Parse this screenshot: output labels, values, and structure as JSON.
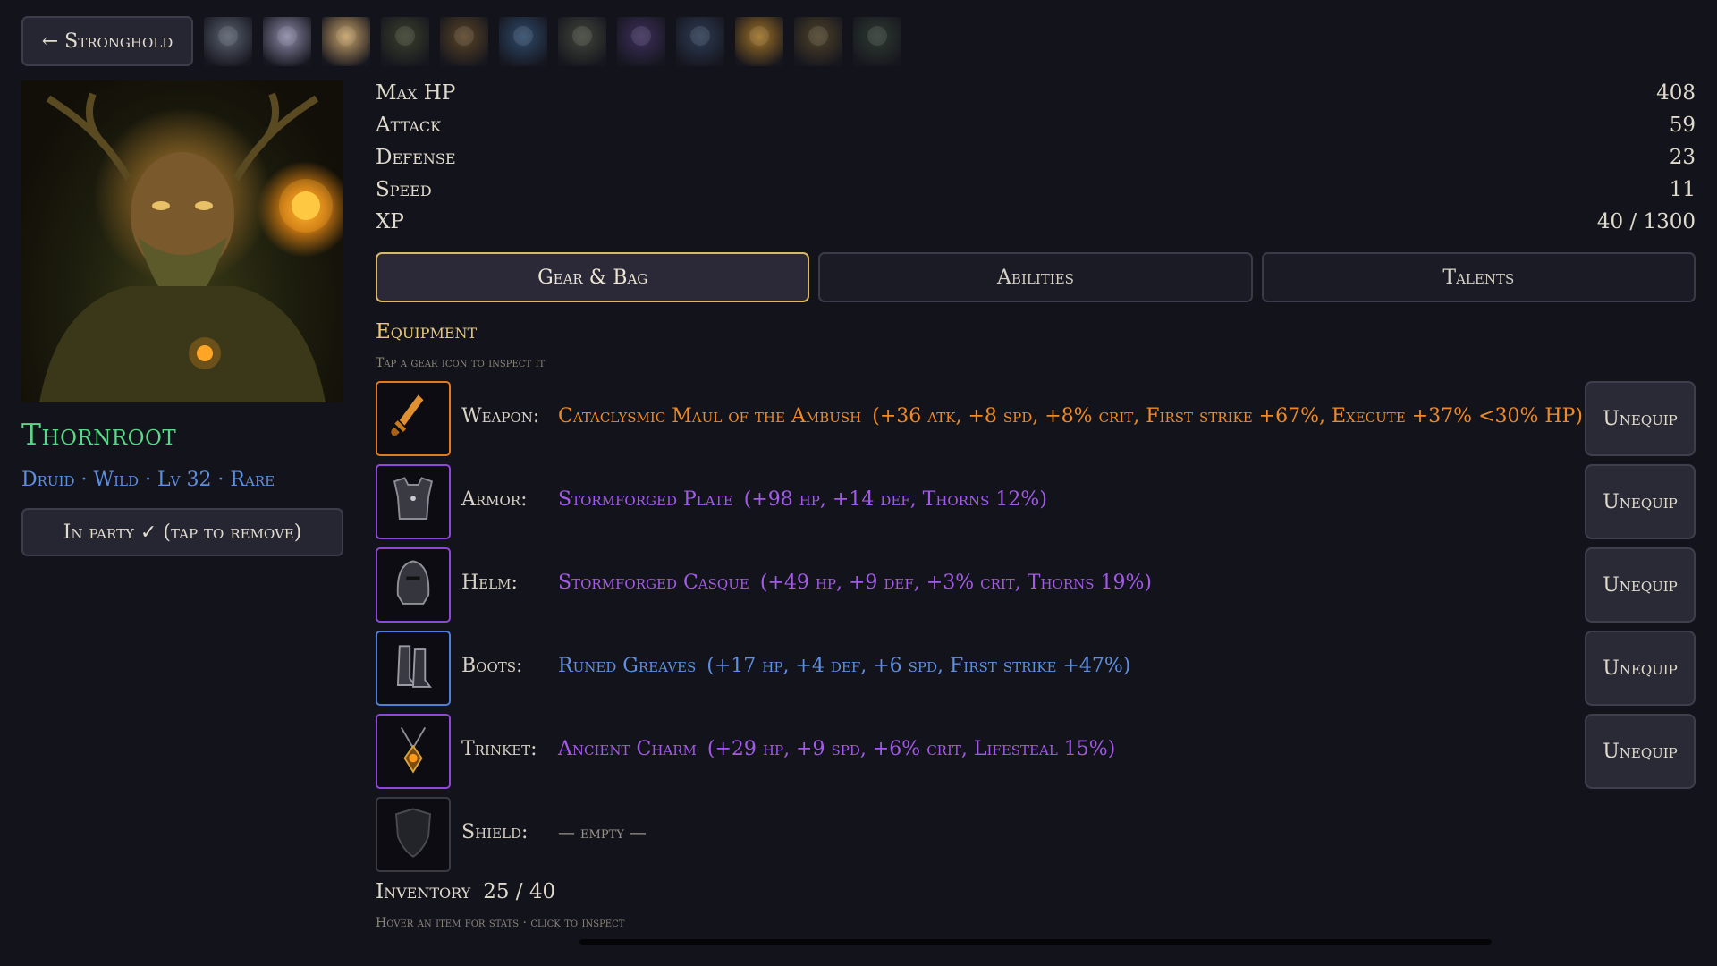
{
  "colors": {
    "background": "#13131c",
    "accent_gold": "#d9b866",
    "hero_name": "#5cd688",
    "hero_sub": "#5f8fe0",
    "legendary": "#f08a24",
    "epic": "#a35ae8",
    "rare": "#5f8fe0"
  },
  "nav": {
    "back_label": "← Stronghold",
    "party_portraits": [
      {
        "name": "party-portrait-1-icon",
        "color": "#5a6270"
      },
      {
        "name": "party-portrait-2-icon",
        "color": "#8b8aa8"
      },
      {
        "name": "party-portrait-3-icon",
        "color": "#c7a268"
      },
      {
        "name": "party-portrait-4-icon",
        "color": "#3b3f2c"
      },
      {
        "name": "party-portrait-5-icon",
        "color": "#5a4426"
      },
      {
        "name": "party-portrait-6-icon",
        "color": "#2e4a6a"
      },
      {
        "name": "party-portrait-7-icon",
        "color": "#40463a"
      },
      {
        "name": "party-portrait-8-icon",
        "color": "#3d2f5c"
      },
      {
        "name": "party-portrait-9-icon",
        "color": "#2d3c55"
      },
      {
        "name": "party-portrait-10-icon",
        "color": "#a07224"
      },
      {
        "name": "party-portrait-11-icon",
        "color": "#4f4228"
      },
      {
        "name": "party-portrait-12-icon",
        "color": "#2e3a30"
      }
    ]
  },
  "hero": {
    "name": "Thornroot",
    "subtitle": "Druid · Wild · Lv 32 · Rare",
    "party_button": "In party ✓ (tap to remove)"
  },
  "stats": [
    {
      "label": "Max HP",
      "value": "408"
    },
    {
      "label": "Attack",
      "value": "59"
    },
    {
      "label": "Defense",
      "value": "23"
    },
    {
      "label": "Speed",
      "value": "11"
    },
    {
      "label": "XP",
      "value": "40 / 1300"
    }
  ],
  "tabs": [
    {
      "label": "Gear & Bag",
      "active": true
    },
    {
      "label": "Abilities",
      "active": false
    },
    {
      "label": "Talents",
      "active": false
    }
  ],
  "equipment": {
    "title": "Equipment",
    "hint": "Tap a gear icon to inspect it",
    "unequip_label": "Unequip",
    "slots": [
      {
        "slot": "Weapon:",
        "item": "Cataclysmic Maul of the Ambush",
        "stats": "(+36 atk, +8 spd, +8% crit, First strike +67%, Execute +37% <30% HP)",
        "color": "#f08a24",
        "border": "#e07a1c",
        "icon": "sword-icon"
      },
      {
        "slot": "Armor:",
        "item": "Stormforged Plate",
        "stats": "(+98 hp, +14 def, Thorns 12%)",
        "color": "#a35ae8",
        "border": "#8f47d8",
        "icon": "chestplate-icon"
      },
      {
        "slot": "Helm:",
        "item": "Stormforged Casque",
        "stats": "(+49 hp, +9 def, +3% crit, Thorns 19%)",
        "color": "#a35ae8",
        "border": "#8f47d8",
        "icon": "helm-icon"
      },
      {
        "slot": "Boots:",
        "item": "Runed Greaves",
        "stats": "(+17 hp, +4 def, +6 spd, First strike +47%)",
        "color": "#5f8fe0",
        "border": "#4f7fd8",
        "icon": "boots-icon"
      },
      {
        "slot": "Trinket:",
        "item": "Ancient Charm",
        "stats": "(+29 hp, +9 spd, +6% crit, Lifesteal 15%)",
        "color": "#a35ae8",
        "border": "#8f47d8",
        "icon": "amulet-icon"
      }
    ],
    "empty_slot": {
      "slot": "Shield:",
      "text": "— empty —",
      "icon": "shield-icon"
    }
  },
  "inventory": {
    "title": "Inventory",
    "count": "25 / 40",
    "hint": "Hover an item for stats · click to inspect"
  }
}
